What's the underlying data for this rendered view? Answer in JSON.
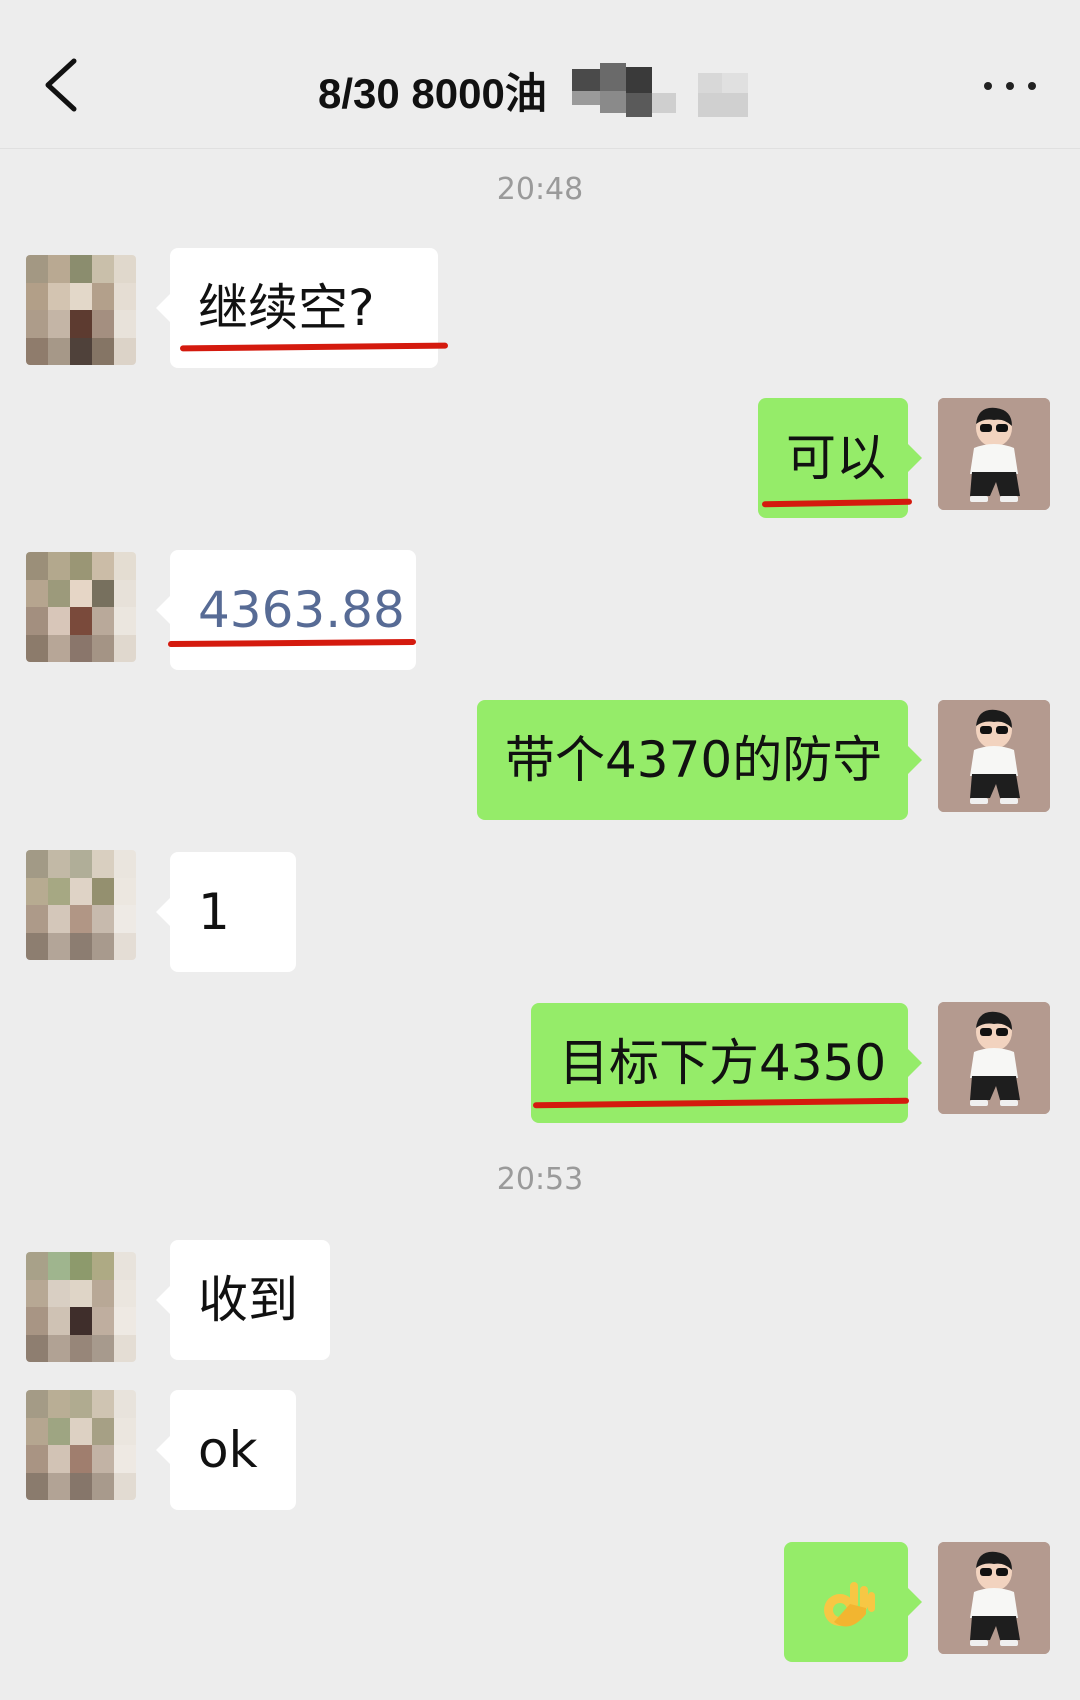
{
  "header": {
    "back_icon": "chevron-left-icon",
    "title": "8/30  8000油",
    "more_icon": "more-dots-icon"
  },
  "timestamps": [
    "20:48",
    "20:53"
  ],
  "messages": [
    {
      "side": "left",
      "text": "继续空?",
      "underline": true
    },
    {
      "side": "right",
      "text": "可以",
      "underline": true
    },
    {
      "side": "left",
      "text": "4363.88",
      "underline": true,
      "link": true
    },
    {
      "side": "right",
      "text": "带个4370的防守",
      "underline": false
    },
    {
      "side": "left",
      "text": "1",
      "underline": false
    },
    {
      "side": "right",
      "text": "目标下方4350",
      "underline": true
    },
    {
      "side": "left",
      "text": "收到",
      "underline": false
    },
    {
      "side": "left",
      "text": "ok",
      "underline": false
    },
    {
      "side": "right",
      "text": "👌",
      "underline": false,
      "emoji_name": "ok-hand-emoji"
    }
  ],
  "colors": {
    "background": "#ededed",
    "incoming_bubble": "#ffffff",
    "outgoing_bubble": "#95ec69",
    "annotation_underline": "#d41a0e",
    "link_text": "#576b95"
  }
}
